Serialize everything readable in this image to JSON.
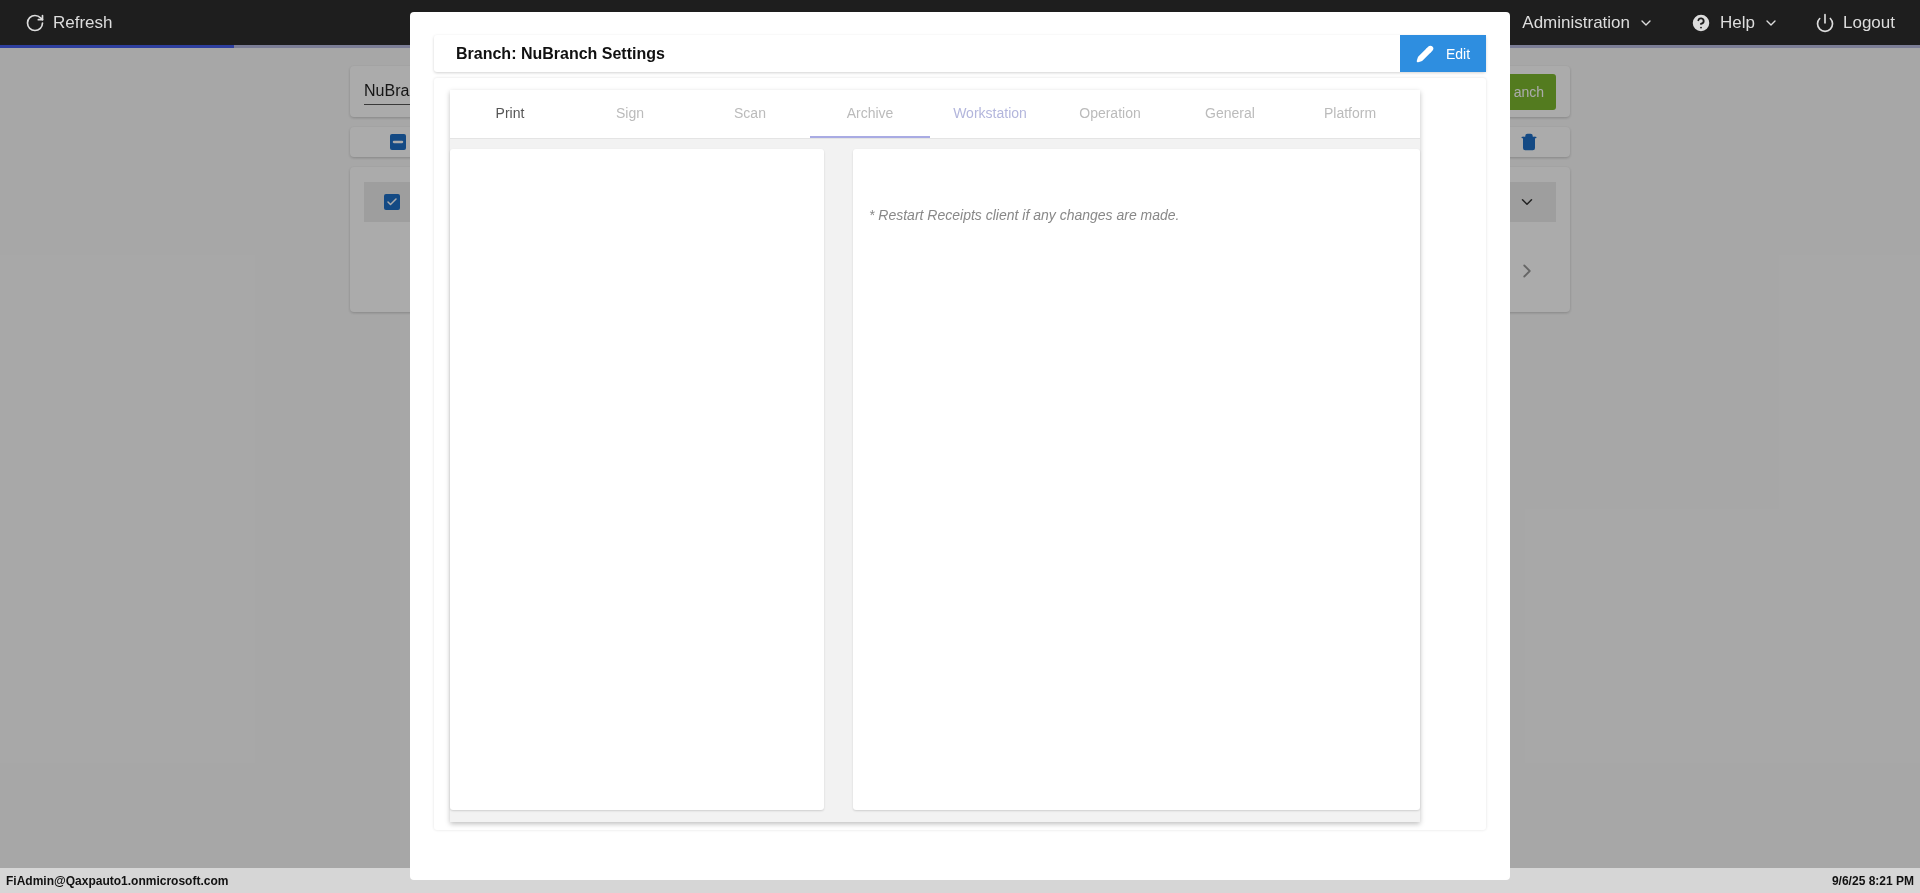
{
  "top_bar": {
    "refresh": "Refresh",
    "menus": [
      {
        "label": "Administration",
        "kind": "dropdown"
      },
      {
        "label": "Help",
        "kind": "help"
      },
      {
        "label": "Logout",
        "kind": "logout"
      }
    ],
    "progress": {
      "level": 0.122
    }
  },
  "background": {
    "name_field": {
      "value": "NuBra"
    },
    "add_button": "anch",
    "select_all": {
      "indeterminate": true
    },
    "row": {
      "checked": true
    }
  },
  "modal": {
    "title": "Branch: NuBranch Settings",
    "edit_button": "Edit",
    "tabs": [
      {
        "label": "Print",
        "selected": false,
        "kind": "enabled"
      },
      {
        "label": "Sign",
        "selected": false,
        "kind": "disabled"
      },
      {
        "label": "Scan",
        "selected": false,
        "kind": "disabled"
      },
      {
        "label": "Archive",
        "selected": true,
        "kind": "disabled"
      },
      {
        "label": "Workstation",
        "selected": false,
        "kind": "focused"
      },
      {
        "label": "Operation",
        "selected": false,
        "kind": "disabled"
      },
      {
        "label": "General",
        "selected": false,
        "kind": "disabled"
      },
      {
        "label": "Platform",
        "selected": false,
        "kind": "disabled"
      }
    ],
    "note": "* Restart Receipts client if any changes are made."
  },
  "status_bar": {
    "user": "FiAdmin@Qaxpauto1.onmicrosoft.com",
    "datetime": "9/6/25 8:21 PM"
  }
}
